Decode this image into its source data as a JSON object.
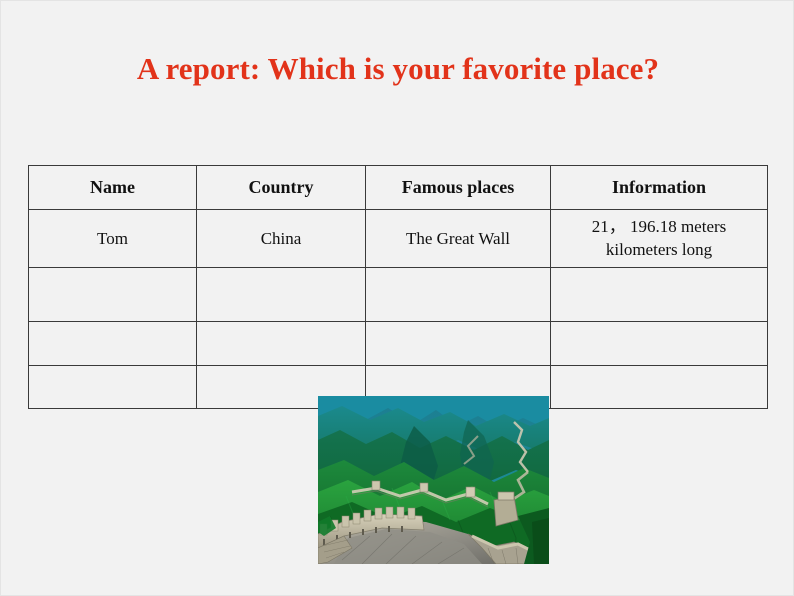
{
  "slide": {
    "background_color": "#f2f2f2",
    "title": "A report: Which is your favorite place?",
    "title_color": "#e2331a"
  },
  "table": {
    "headers": [
      "Name",
      "Country",
      "Famous places",
      "Information"
    ],
    "rows": [
      {
        "name": "Tom",
        "country": "China",
        "places": "The Great Wall",
        "information_line1": "21，  196.18 meters",
        "information_line2": "kilometers long"
      },
      {
        "name": "",
        "country": "",
        "places": "",
        "information_line1": "",
        "information_line2": ""
      },
      {
        "name": "",
        "country": "",
        "places": "",
        "information_line1": "",
        "information_line2": ""
      },
      {
        "name": "",
        "country": "",
        "places": "",
        "information_line1": "",
        "information_line2": ""
      }
    ],
    "border_color": "#3a3a3a"
  },
  "photo": {
    "caption": "great-wall-of-china-photo",
    "sky_color": "#1f8fa0",
    "mountain_color": "#1d6b3c",
    "wall_color": "#b9b39a"
  }
}
